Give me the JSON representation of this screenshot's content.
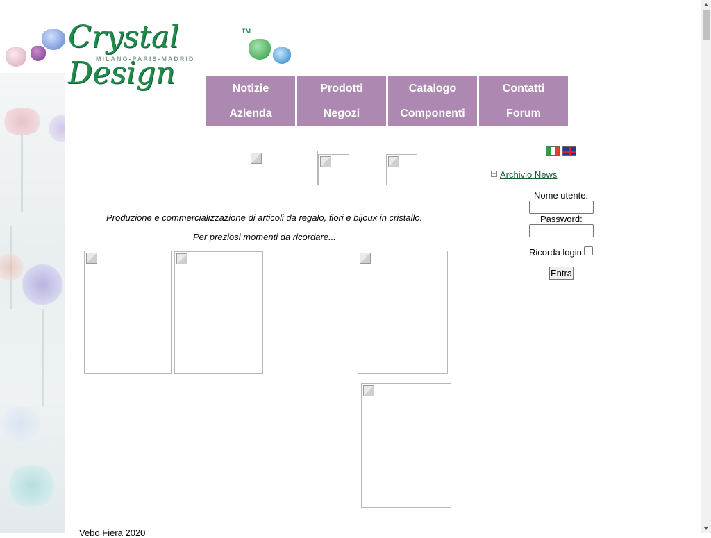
{
  "logo": {
    "brand": "Crystal Design",
    "trademark": "TM",
    "cities": "MILANO-PARIS-MADRID"
  },
  "nav": {
    "items": [
      {
        "label": "Notizie"
      },
      {
        "label": "Prodotti"
      },
      {
        "label": "Catalogo"
      },
      {
        "label": "Contatti"
      },
      {
        "label": "Azienda"
      },
      {
        "label": "Negozi"
      },
      {
        "label": "Componenti"
      },
      {
        "label": "Forum"
      }
    ],
    "color": "#ad89b1"
  },
  "main": {
    "tagline": "Produzione e commercializzazione di articoli da regalo, fiori e bijoux in cristallo.",
    "slogan": "Per preziosi momenti da ricordare..."
  },
  "sidebar": {
    "languages": [
      "italian-flag-icon",
      "english-flag-icon"
    ],
    "news_link": "Archivio News",
    "login": {
      "username_label": "Nome utente:",
      "username_value": "",
      "password_label": "Password:",
      "password_value": "",
      "remember_label": "Ricorda login",
      "remember_checked": false,
      "submit_label": "Entra"
    }
  },
  "footer": {
    "text": "Vebo Fiera 2020"
  },
  "colors": {
    "brand_green": "#1f8a4c",
    "link_green": "#1a5c33"
  }
}
